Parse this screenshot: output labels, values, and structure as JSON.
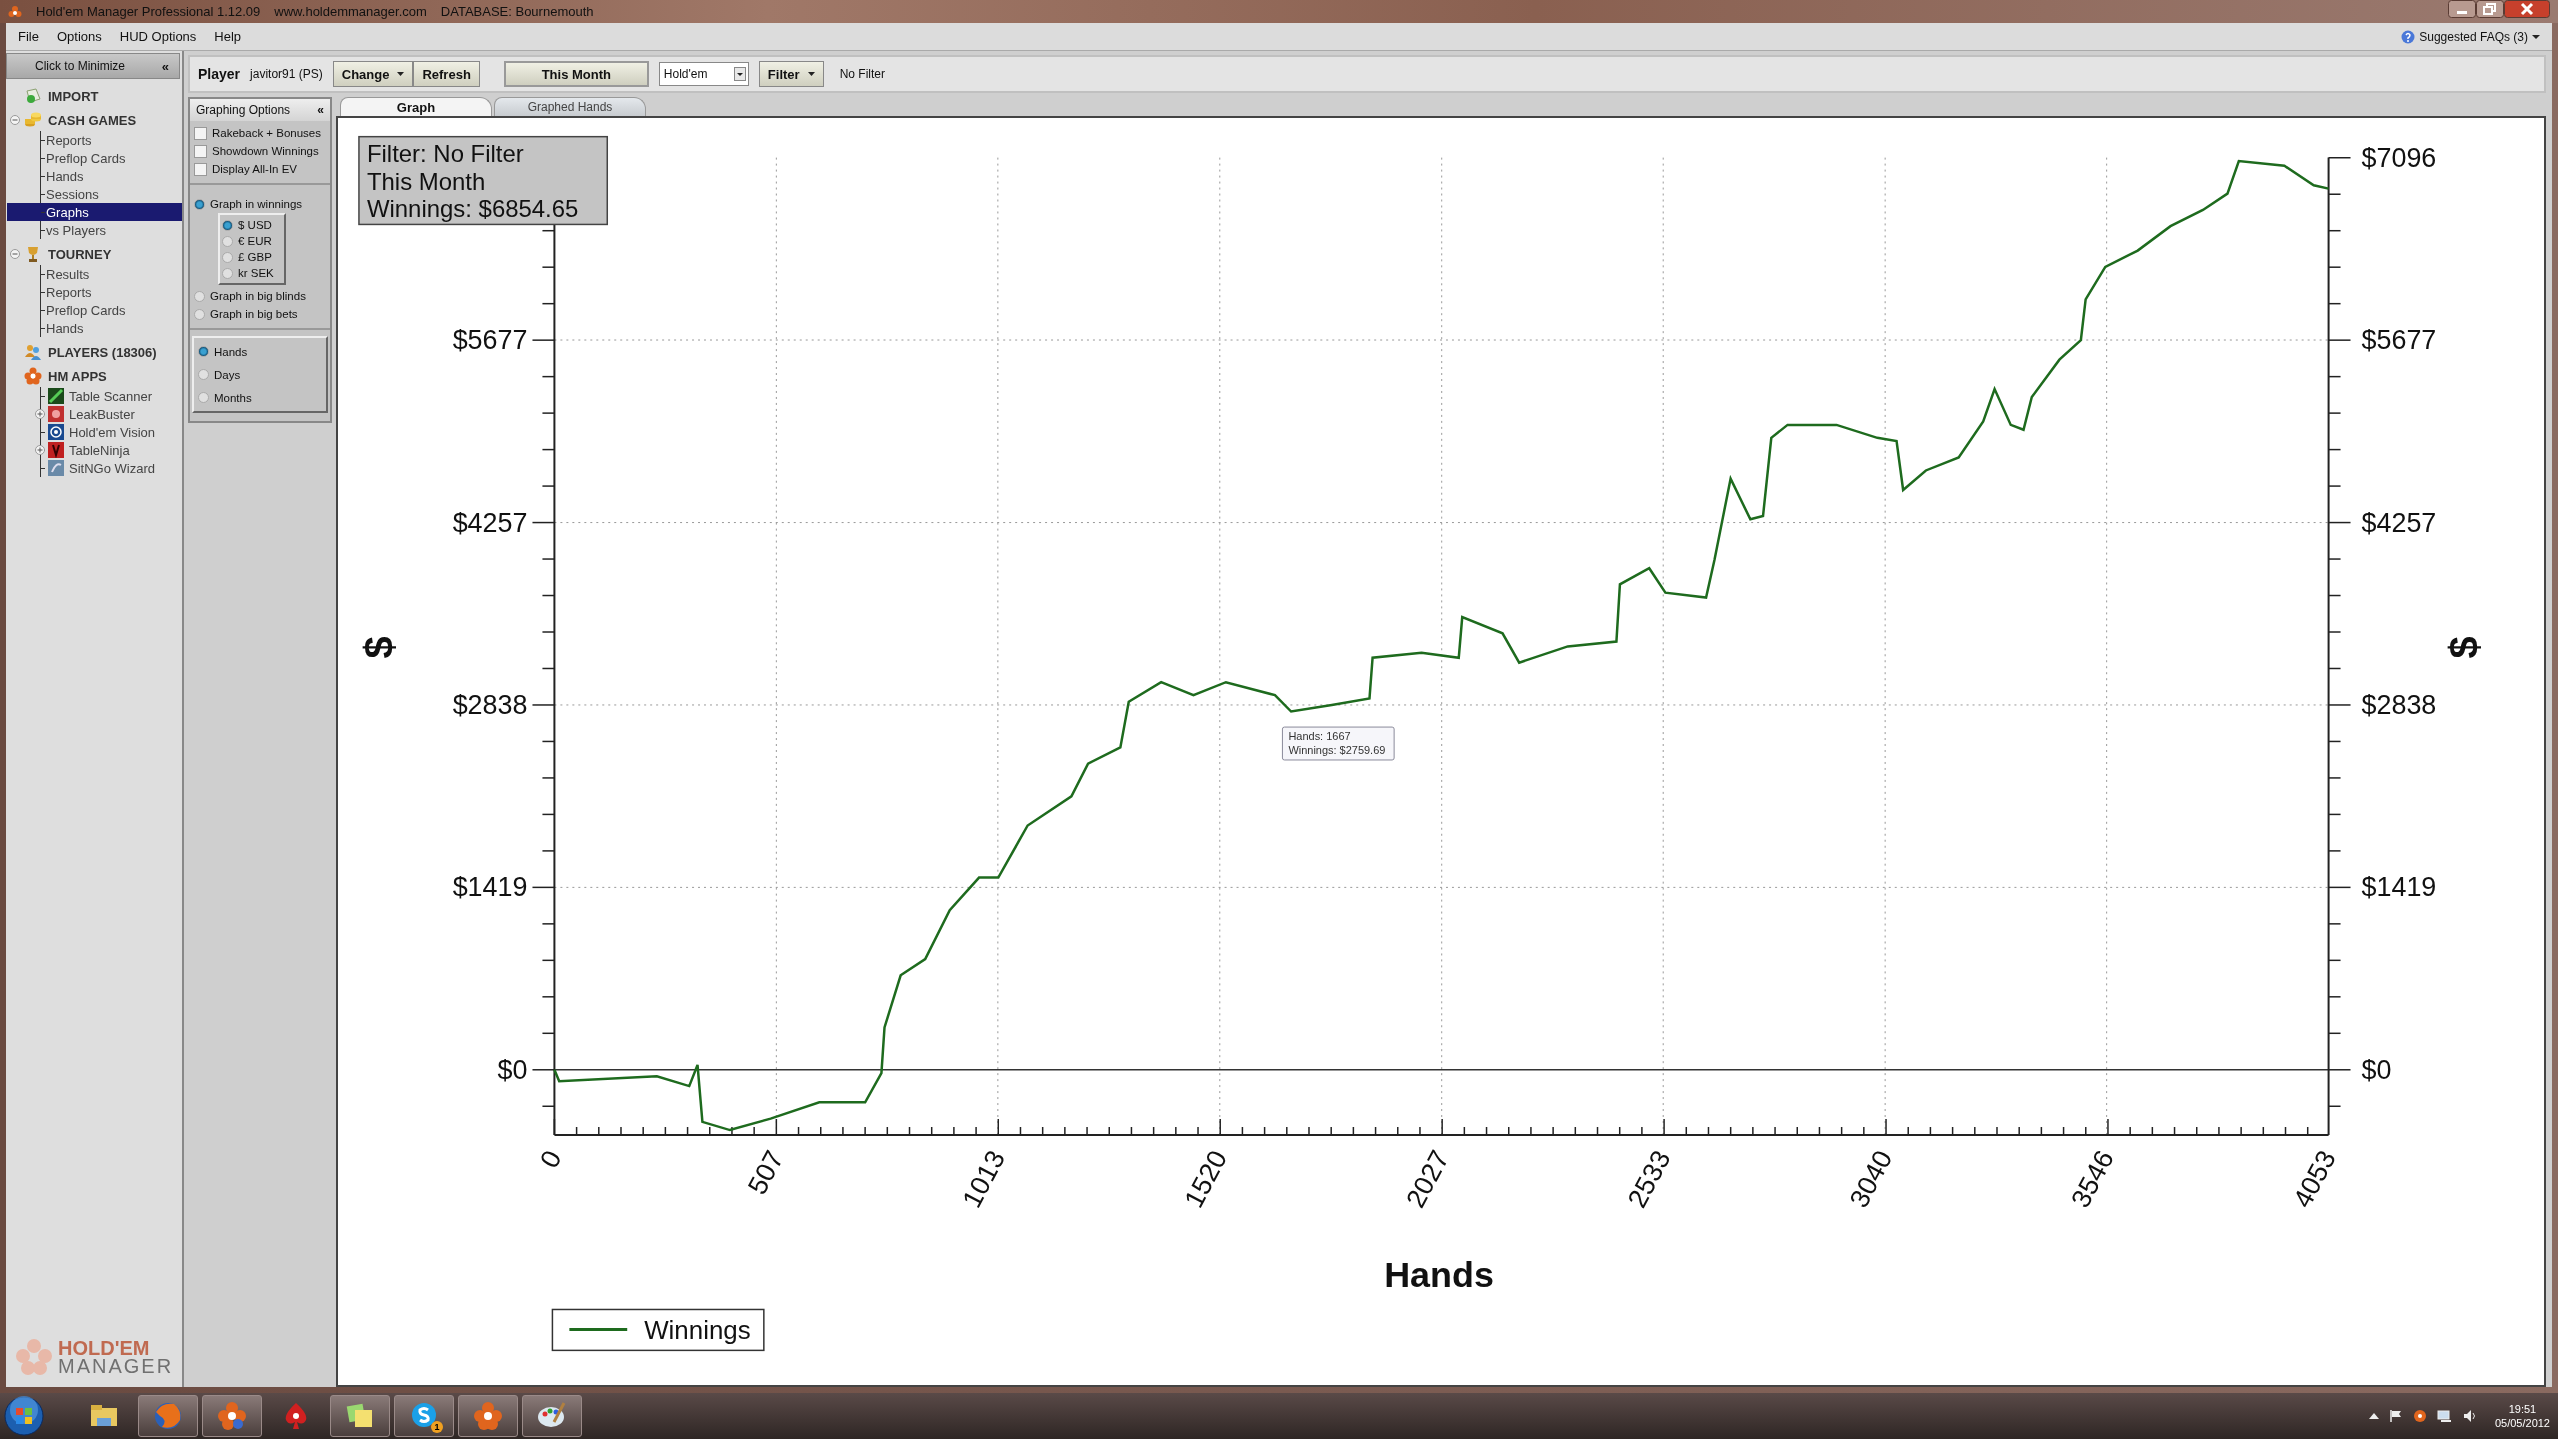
{
  "window": {
    "title": "Hold'em Manager Professional 1.12.09",
    "website": "www.holdemmanager.com",
    "database": "DATABASE: Bournemouth"
  },
  "menu": [
    {
      "label": "File"
    },
    {
      "label": "Options"
    },
    {
      "label": "HUD Options"
    },
    {
      "label": "Help"
    }
  ],
  "help_link": {
    "label": "Suggested FAQs (3)"
  },
  "sidebar": {
    "minimize": {
      "label": "Click to Minimize",
      "glyph": "«"
    },
    "tree": [
      {
        "label": "IMPORT",
        "selected": false
      },
      {
        "label": "CASH GAMES",
        "selected": false,
        "expanded": true,
        "children": [
          {
            "label": "Reports",
            "selected": false
          },
          {
            "label": "Preflop Cards",
            "selected": false
          },
          {
            "label": "Hands",
            "selected": false
          },
          {
            "label": "Sessions",
            "selected": false
          },
          {
            "label": "Graphs",
            "selected": true
          },
          {
            "label": "vs Players",
            "selected": false
          }
        ]
      },
      {
        "label": "TOURNEY",
        "selected": false,
        "expanded": true,
        "children": [
          {
            "label": "Results",
            "selected": false
          },
          {
            "label": "Reports",
            "selected": false
          },
          {
            "label": "Preflop Cards",
            "selected": false
          },
          {
            "label": "Hands",
            "selected": false
          }
        ]
      },
      {
        "label": "PLAYERS (18306)",
        "selected": false
      },
      {
        "label": "HM APPS",
        "selected": false,
        "children": [
          {
            "label": "Table Scanner",
            "selected": false
          },
          {
            "label": "LeakBuster",
            "selected": false,
            "expanded": false
          },
          {
            "label": "Hold'em Vision",
            "selected": false
          },
          {
            "label": "TableNinja",
            "selected": false,
            "expanded": false
          },
          {
            "label": "SitNGo Wizard",
            "selected": false
          }
        ]
      }
    ],
    "logo": [
      "HOLD'EM",
      "MANAGER"
    ]
  },
  "toolbar": {
    "player_label": "Player",
    "player": "javitor91 (PS)",
    "buttons": [
      {
        "label": "Change",
        "dropdown": true
      },
      {
        "label": "Refresh",
        "dropdown": false
      }
    ],
    "period": {
      "label": "This Month"
    },
    "game": {
      "value": "Hold'em"
    },
    "filter": {
      "label": "Filter",
      "dropdown": true
    },
    "filter_status": "No Filter"
  },
  "options": {
    "title": "Graphing Options",
    "glyph": "«",
    "checkboxes": [
      {
        "label": "Rakeback + Bonuses",
        "checked": false
      },
      {
        "label": "Showdown Winnings",
        "checked": false
      },
      {
        "label": "Display All-In EV",
        "checked": false
      }
    ],
    "units": [
      {
        "label": "Graph in winnings",
        "selected": true,
        "currencies": [
          {
            "label": "$ USD",
            "selected": true
          },
          {
            "label": "€ EUR",
            "selected": false
          },
          {
            "label": "£ GBP",
            "selected": false
          },
          {
            "label": "kr SEK",
            "selected": false
          }
        ]
      },
      {
        "label": "Graph in big blinds",
        "selected": false
      },
      {
        "label": "Graph in big bets",
        "selected": false
      }
    ],
    "x_axis": [
      {
        "label": "Hands",
        "selected": true
      },
      {
        "label": "Days",
        "selected": false
      },
      {
        "label": "Months",
        "selected": false
      }
    ]
  },
  "graph": {
    "tabs": [
      {
        "label": "Graph",
        "selected": true
      },
      {
        "label": "Graphed Hands",
        "selected": false
      }
    ],
    "info": [
      "Filter: No Filter",
      "This Month",
      "Winnings: $6854.65"
    ],
    "tooltip": [
      "Hands: 1667",
      "Winnings: $2759.69"
    ],
    "right_axis": {
      "label": "$",
      "ticks": [
        "$7096",
        "$5677",
        "$4257",
        "$2838",
        "$1419",
        "$0"
      ]
    },
    "chart_data": {
      "type": "line",
      "grid": true,
      "xlabel": "Hands",
      "ylabel": "$",
      "xlim": [
        0,
        4053
      ],
      "ylim": [
        -507,
        7096
      ],
      "xticks": [
        0,
        507,
        1013,
        1520,
        2027,
        2533,
        3040,
        3546,
        4053
      ],
      "yticks": [
        {
          "value": 0,
          "label": "$0"
        },
        {
          "value": 1419,
          "label": "$1419"
        },
        {
          "value": 2838,
          "label": "$2838"
        },
        {
          "value": 4257,
          "label": "$4257"
        },
        {
          "value": 5677,
          "label": "$5677"
        }
      ],
      "x": [
        0,
        11,
        234,
        308,
        327,
        338,
        401,
        494,
        605,
        710,
        747,
        754,
        791,
        847,
        903,
        970,
        1014,
        1081,
        1181,
        1219,
        1293,
        1312,
        1386,
        1460,
        1534,
        1646,
        1683,
        1776,
        1862,
        1869,
        1981,
        2066,
        2074,
        2166,
        2204,
        2315,
        2426,
        2434,
        2501,
        2538,
        2631,
        2650,
        2687,
        2732,
        2761,
        2780,
        2817,
        2929,
        3022,
        3066,
        3081,
        3133,
        3208,
        3264,
        3290,
        3327,
        3356,
        3375,
        3438,
        3487,
        3498,
        3543,
        3617,
        3692,
        3766,
        3822,
        3848,
        3952,
        4019,
        4053
      ],
      "series": [
        {
          "name": "Winnings",
          "color": "#1e6b1e",
          "values": [
            0,
            -89,
            -51,
            -127,
            38,
            -405,
            -469,
            -380,
            -253,
            -253,
            -25,
            329,
            735,
            861,
            1242,
            1495,
            1495,
            1900,
            2128,
            2382,
            2508,
            2863,
            3015,
            2914,
            3015,
            2914,
            2787,
            2838,
            2889,
            3205,
            3243,
            3205,
            3522,
            3395,
            3167,
            3294,
            3332,
            3776,
            3902,
            3712,
            3674,
            3966,
            4599,
            4282,
            4308,
            4916,
            5017,
            5017,
            4916,
            4891,
            4510,
            4662,
            4764,
            5043,
            5296,
            5017,
            4979,
            5233,
            5524,
            5676,
            5993,
            6246,
            6373,
            6563,
            6689,
            6816,
            7070,
            7032,
            6880,
            6855
          ]
        }
      ]
    }
  },
  "taskbar": {
    "apps": [
      {
        "running": false
      },
      {
        "running": true
      },
      {
        "running": true
      },
      {
        "running": false
      },
      {
        "running": true
      },
      {
        "running": true,
        "badge": "1"
      },
      {
        "running": true
      },
      {
        "running": true
      }
    ],
    "clock": {
      "time": "19:51",
      "date": "05/05/2012"
    }
  }
}
